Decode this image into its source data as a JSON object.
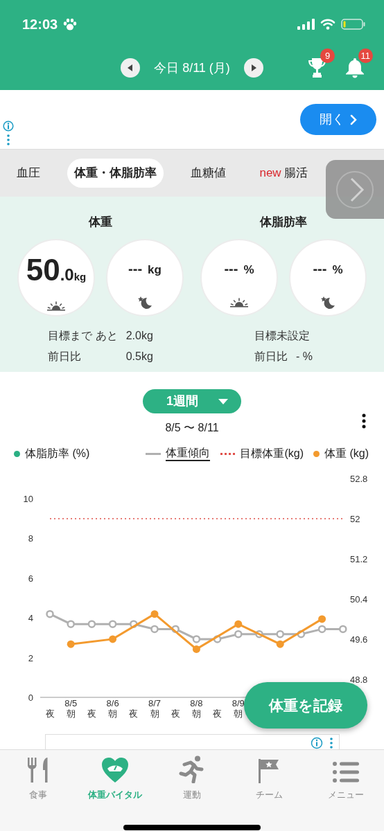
{
  "status_bar": {
    "time": "12:03"
  },
  "header": {
    "date": "今日 8/11 (月)",
    "trophy_badge": "9",
    "bell_badge": "11"
  },
  "ad_banner": {
    "button": "開く"
  },
  "tabs": [
    {
      "label": "血圧",
      "selected": false
    },
    {
      "label": "体重・体脂肪率",
      "selected": true
    },
    {
      "label": "血糖値",
      "selected": false
    },
    {
      "label": "腸活",
      "badge": "new",
      "selected": false
    }
  ],
  "summary": [
    {
      "title": "体重",
      "readings": [
        {
          "kind": "morning",
          "value": "50",
          "decimal": ".0",
          "unit": "kg"
        },
        {
          "kind": "night",
          "value": "---",
          "unit": "kg"
        }
      ],
      "rows": [
        {
          "label": "目標まで あと",
          "value": "2.0kg"
        },
        {
          "label": "前日比",
          "value": "0.5kg"
        }
      ]
    },
    {
      "title": "体脂肪率",
      "readings": [
        {
          "kind": "morning",
          "value": "---",
          "unit": "%"
        },
        {
          "kind": "night",
          "value": "---",
          "unit": "%"
        }
      ],
      "rows": [
        {
          "label": "目標未設定"
        },
        {
          "label": "前日比",
          "value": "- %"
        }
      ]
    }
  ],
  "chart_section": {
    "period": "1週間",
    "range": "8/5 〜 8/11",
    "legend": [
      {
        "label": "体脂肪率 (%)",
        "kind": "dot",
        "color": "#2bb084",
        "selected": false
      },
      {
        "label": "体重傾向",
        "kind": "line",
        "color": "#b0b0b0",
        "selected": true
      },
      {
        "label": "目標体重(kg)",
        "kind": "dotted",
        "color": "#e0504a",
        "selected": false
      },
      {
        "label": "体重 (kg)",
        "kind": "dot",
        "color": "#f39a2e",
        "selected": false
      }
    ],
    "left_axis_ticks": [
      "10",
      "8",
      "6",
      "4",
      "2",
      "0"
    ],
    "chart_data": {
      "type": "line",
      "categories": [
        "夜",
        "8/5 朝",
        "夜",
        "8/6 朝",
        "夜",
        "8/7 朝",
        "夜",
        "8/8 朝",
        "夜",
        "8/9 朝",
        null,
        null,
        null,
        null,
        null
      ],
      "yticks": [
        52.8,
        52,
        51.2,
        50.4,
        49.6,
        48.8
      ],
      "ylim": [
        48.44,
        52.8
      ],
      "series": [
        {
          "color": "#e0504a",
          "line_style": "dotted",
          "values": [
            52,
            52,
            52,
            52,
            52,
            52,
            52,
            52,
            52,
            52,
            52,
            52,
            52,
            52,
            52
          ]
        },
        {
          "color": "#b0b0b0",
          "marker": "hollow-circle",
          "values": [
            50.1,
            49.9,
            49.9,
            49.9,
            49.9,
            49.8,
            49.8,
            49.6,
            49.6,
            49.7,
            49.7,
            49.7,
            49.7,
            49.8,
            49.8
          ]
        },
        {
          "color": "#f39a2e",
          "marker": "circle",
          "values": [
            null,
            49.5,
            null,
            49.6,
            null,
            50.1,
            null,
            49.4,
            null,
            49.9,
            null,
            49.5,
            null,
            50.0,
            null
          ]
        }
      ]
    }
  },
  "record_button": "体重を記録",
  "bottom_nav": [
    {
      "label": "食事",
      "selected": false
    },
    {
      "label": "体重バイタル",
      "selected": true
    },
    {
      "label": "運動",
      "selected": false
    },
    {
      "label": "チーム",
      "selected": false
    },
    {
      "label": "メニュー",
      "selected": false
    }
  ]
}
